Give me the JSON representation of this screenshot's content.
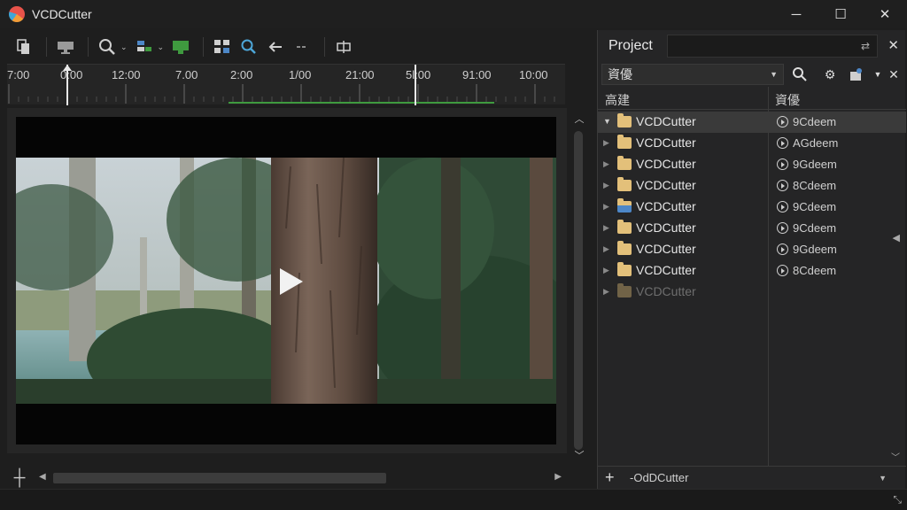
{
  "window": {
    "title": "VCDCutter",
    "minimize": "─",
    "maximize": "☐",
    "close": "✕"
  },
  "toolbar": {
    "icons": [
      "copy-icon",
      "monitor-icon",
      "zoom-icon",
      "layers-icon",
      "green-monitor-icon",
      "grid-icon",
      "search-icon",
      "back-arrow-icon",
      "dash-icon",
      "split-icon"
    ]
  },
  "ruler": {
    "labels": [
      "7:00",
      "0:00",
      "12:00",
      "7.00",
      "2:00",
      "1/00",
      "21:00",
      "5l:00",
      "91:00",
      "10:00"
    ]
  },
  "video": {
    "state": "paused"
  },
  "project": {
    "title": "Project",
    "filter": "資優",
    "col_name": "高建",
    "col_duration": "資優",
    "rows": [
      {
        "name": "VCDCutter",
        "duration": "9Cdeem",
        "selected": true,
        "expanded": true,
        "folder": "yellow"
      },
      {
        "name": "VCDCutter",
        "duration": "AGdeem",
        "folder": "yellow"
      },
      {
        "name": "VCDCutter",
        "duration": "9Gdeem",
        "folder": "yellow"
      },
      {
        "name": "VCDCutter",
        "duration": "8Cdeem",
        "folder": "yellow"
      },
      {
        "name": "VCDCutter",
        "duration": "9Cdeem",
        "folder": "blue"
      },
      {
        "name": "VCDCutter",
        "duration": "9Cdeem",
        "folder": "yellow"
      },
      {
        "name": "VCDCutter",
        "duration": "9Gdeem",
        "folder": "yellow"
      },
      {
        "name": "VCDCutter",
        "duration": "8Cdeem",
        "folder": "yellow"
      },
      {
        "name": "VCDCutter",
        "duration": "",
        "folder": "yellow",
        "dimmed": true
      }
    ],
    "bottom_label": "-OdDCutter"
  },
  "colors": {
    "accent_green": "#3f9a3f",
    "folder_yellow": "#e3c07a",
    "folder_blue": "#4d87c7",
    "selected_row": "#3a3a3a"
  }
}
